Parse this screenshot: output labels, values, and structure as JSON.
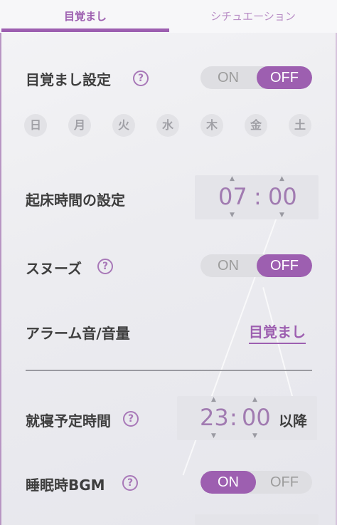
{
  "tabs": [
    {
      "label": "目覚まし",
      "active": true
    },
    {
      "label": "シチュエーション",
      "active": false
    }
  ],
  "alarm": {
    "label": "目覚まし設定",
    "help_icon": "?",
    "toggle": {
      "on": "ON",
      "off": "OFF",
      "selected": "OFF"
    }
  },
  "days": [
    "日",
    "月",
    "火",
    "水",
    "木",
    "金",
    "土"
  ],
  "wake_time": {
    "label": "起床時間の設定",
    "hour": "07",
    "separator": ":",
    "minute": "00"
  },
  "snooze": {
    "label": "スヌーズ",
    "help_icon": "?",
    "toggle": {
      "on": "ON",
      "off": "OFF",
      "selected": "OFF"
    }
  },
  "alarm_sound": {
    "label": "アラーム音/音量",
    "value": "目覚まし"
  },
  "bedtime": {
    "label": "就寝予定時間",
    "help_icon": "?",
    "hour": "23",
    "separator": ":",
    "minute": "00",
    "suffix": "以降"
  },
  "sleep_bgm": {
    "label": "睡眠時BGM",
    "help_icon": "?",
    "toggle": {
      "on": "ON",
      "off": "OFF",
      "selected": "ON"
    }
  },
  "icons": {
    "up_arrow": "▲",
    "down_arrow": "▼"
  },
  "colors": {
    "accent": "#9d5fb0",
    "toggle_bg": "#dedee2",
    "time_digit": "#a17bb1"
  }
}
